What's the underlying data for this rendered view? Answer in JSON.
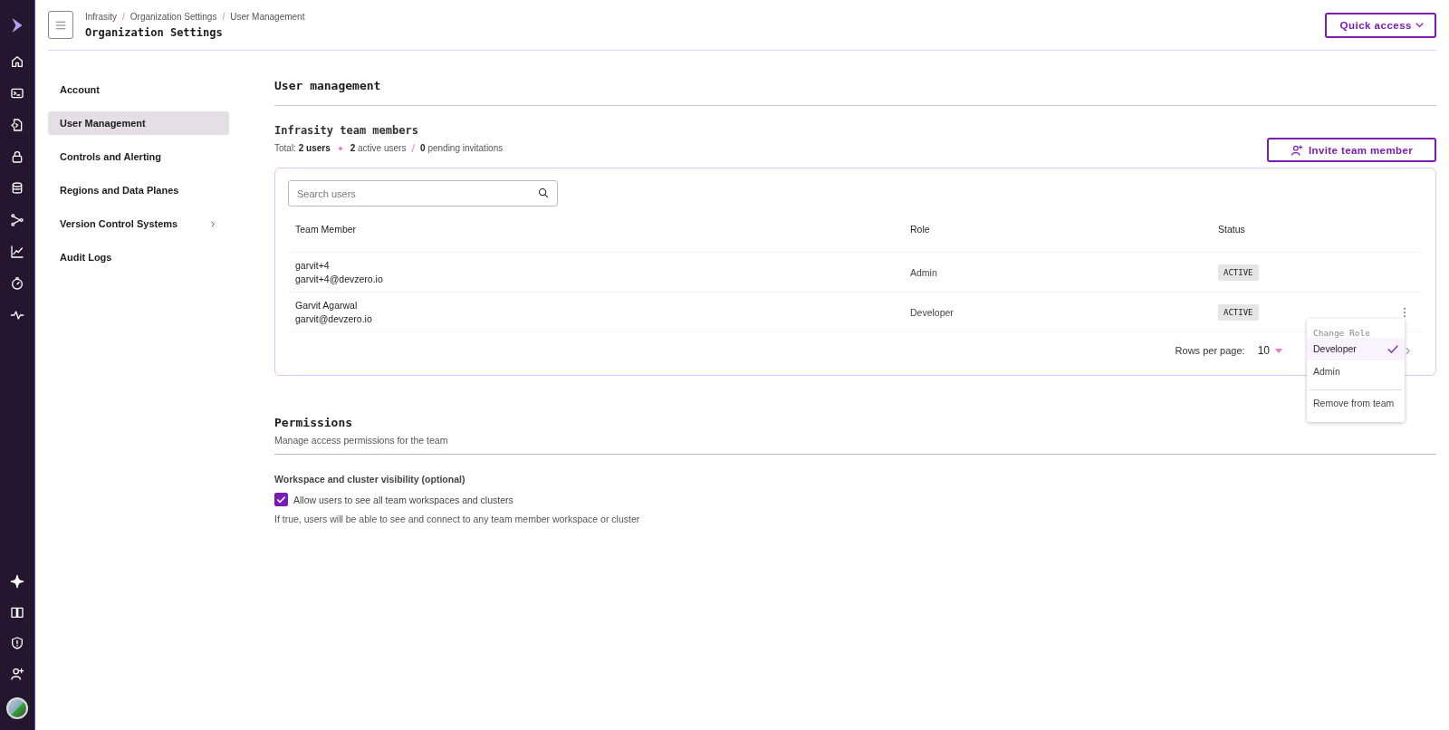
{
  "header": {
    "breadcrumb": [
      {
        "label": "Infrasity"
      },
      {
        "label": "Organization Settings",
        "separator": "/"
      },
      {
        "label": "User Management",
        "separator": "/"
      }
    ],
    "title": "Organization Settings",
    "quick_access": "Quick access"
  },
  "nav": {
    "items": [
      {
        "label": "Account",
        "selected": false
      },
      {
        "label": "User Management",
        "selected": true
      },
      {
        "label": "Controls and Alerting",
        "selected": false
      },
      {
        "label": "Regions and Data Planes",
        "selected": false
      },
      {
        "label": "Version Control Systems",
        "selected": false,
        "expandable": true
      },
      {
        "label": "Audit Logs",
        "selected": false
      }
    ]
  },
  "section_title": "User management",
  "team": {
    "title": "Infrasity team members",
    "total": "Total: **2 users**",
    "active": "**2** active users",
    "separator": "/",
    "pending": "**0** pending invitations",
    "invite_button": "Invite team member"
  },
  "table": {
    "search": {
      "placeholder": "Search users"
    },
    "columns": [
      "Team Member",
      "Role",
      "Status"
    ],
    "rows": [
      {
        "name": "garvit+4",
        "email": "garvit+4@devzero.io",
        "role": "Admin",
        "status": "ACTIVE",
        "menu": false
      },
      {
        "name": "Garvit Agarwal",
        "email": "garvit@devzero.io",
        "role": "Developer",
        "status": "ACTIVE",
        "menu": true
      }
    ],
    "rows_per_page_label": "Rows per page:",
    "rows_per_page": "10"
  },
  "role_menu": {
    "title": "Change Role",
    "options": [
      {
        "label": "Developer",
        "selected": true
      },
      {
        "label": "Admin",
        "selected": false
      }
    ],
    "remove": "Remove from team"
  },
  "permissions": {
    "title": "Permissions",
    "subtitle": "Manage access permissions for the team",
    "group_title": "Workspace and cluster visibility (optional)",
    "checkbox": {
      "label": "Allow users to see all team workspaces and clusters",
      "checked": true
    },
    "help": "If true, users will be able to see and connect to any team member workspace or cluster"
  }
}
